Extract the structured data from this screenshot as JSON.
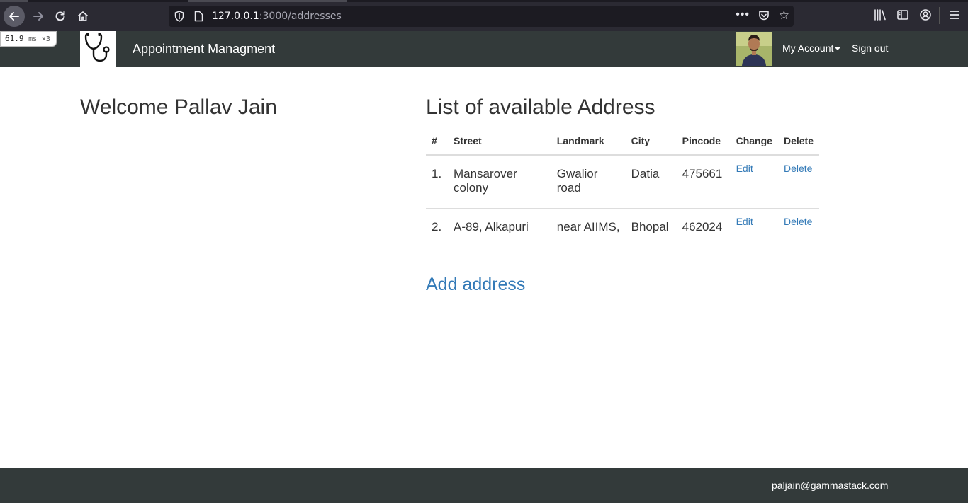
{
  "browser": {
    "url_host": "127.0.0.1",
    "url_path": ":3000/addresses",
    "timing_value": "61.9",
    "timing_unit": "ms",
    "timing_count": "×3"
  },
  "navbar": {
    "brand": "Appointment Managment",
    "my_account": "My Account",
    "sign_out": "Sign out"
  },
  "main": {
    "welcome": "Welcome Pallav Jain",
    "list_title": "List of available Address",
    "columns": [
      "#",
      "Street",
      "Landmark",
      "City",
      "Pincode",
      "Change",
      "Delete"
    ],
    "rows": [
      {
        "num": "1.",
        "street": "Mansarover colony",
        "landmark": "Gwalior road",
        "city": "Datia",
        "pincode": "475661",
        "edit": "Edit",
        "delete": "Delete"
      },
      {
        "num": "2.",
        "street": "A-89, Alkapuri",
        "landmark": "near AIIMS,",
        "city": "Bhopal",
        "pincode": "462024",
        "edit": "Edit",
        "delete": "Delete"
      }
    ],
    "add_address": "Add address"
  },
  "footer": {
    "email": "paljain@gammastack.com"
  },
  "colors": {
    "navbar_bg": "#333a3a",
    "link": "#337ab7",
    "browser_bg": "#2b2a33"
  },
  "icons": [
    "back-arrow-icon",
    "forward-arrow-icon",
    "reload-icon",
    "home-icon",
    "shield-icon",
    "page-icon",
    "more-dots-icon",
    "pocket-icon",
    "bookmark-star-icon",
    "library-icon",
    "sidebar-icon",
    "account-icon",
    "hamburger-menu-icon",
    "stethoscope-icon"
  ]
}
